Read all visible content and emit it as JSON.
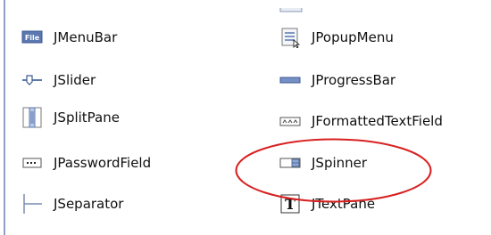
{
  "palette": {
    "left_rule": "#8fa0c0",
    "highlight_oval": "#d82020",
    "icon_blue": "#5b78b0",
    "icon_gray": "#7a7a7a"
  },
  "components": {
    "left": [
      {
        "label": "JMenuBar",
        "icon": "menubar-icon",
        "badge": "File"
      },
      {
        "label": "JSlider",
        "icon": "slider-icon"
      },
      {
        "label": "JSplitPane",
        "icon": "splitpane-icon"
      },
      {
        "label": "JPasswordField",
        "icon": "passwordfield-icon"
      },
      {
        "label": "JSeparator",
        "icon": "separator-icon"
      }
    ],
    "right": [
      {
        "label": "JPopupMenu",
        "icon": "popupmenu-icon"
      },
      {
        "label": "JProgressBar",
        "icon": "progressbar-icon"
      },
      {
        "label": "JFormattedTextField",
        "icon": "formattedtextfield-icon"
      },
      {
        "label": "JSpinner",
        "icon": "spinner-icon"
      },
      {
        "label": "JTextPane",
        "icon": "textpane-icon",
        "badge": "T"
      }
    ]
  },
  "highlight": {
    "target": "JSpinner",
    "shape": "ellipse"
  }
}
